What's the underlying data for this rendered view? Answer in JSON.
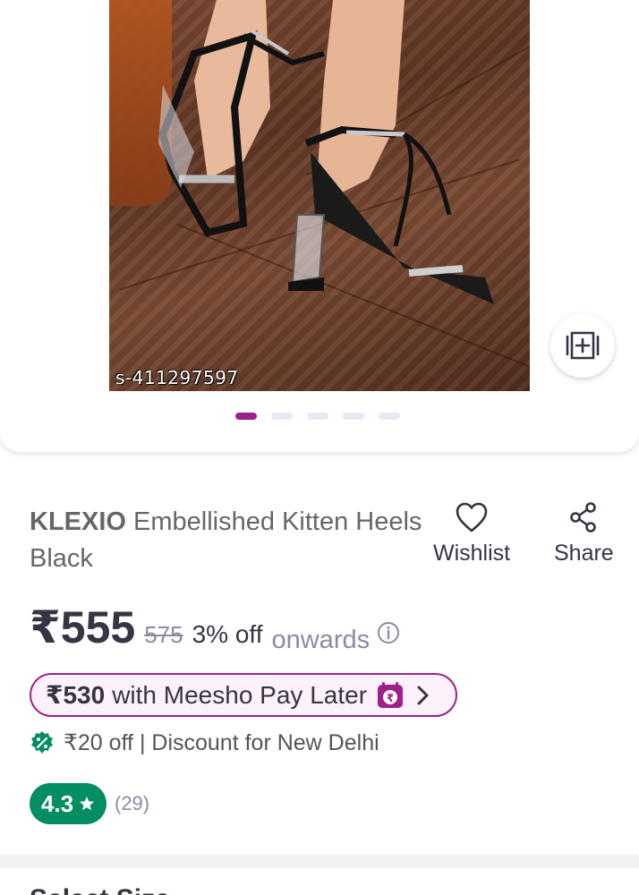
{
  "product": {
    "sku_label": "s-411297597",
    "brand": "KLEXIO",
    "name": "Embellished Kitten Heels Black"
  },
  "gallery": {
    "image_count": 5,
    "active_index": 0,
    "add_icon": "add-to-collection-icon"
  },
  "actions": {
    "wishlist_label": "Wishlist",
    "share_label": "Share",
    "wishlist_icon": "heart-icon",
    "share_icon": "share-icon"
  },
  "price": {
    "current": "₹555",
    "mrp": "575",
    "discount": "3% off",
    "onwards": "onwards"
  },
  "pay_later": {
    "amount": "₹530",
    "text": "with Meesho Pay Later"
  },
  "discount_offer": {
    "text": "₹20 off | Discount for New Delhi"
  },
  "rating": {
    "value": "4.3",
    "count": "(29)"
  },
  "next_section": {
    "title": "Select Size"
  },
  "colors": {
    "accent": "#9f2089",
    "rating_green": "#038d63",
    "text_primary": "#353543",
    "text_secondary": "#8b8ba3"
  }
}
